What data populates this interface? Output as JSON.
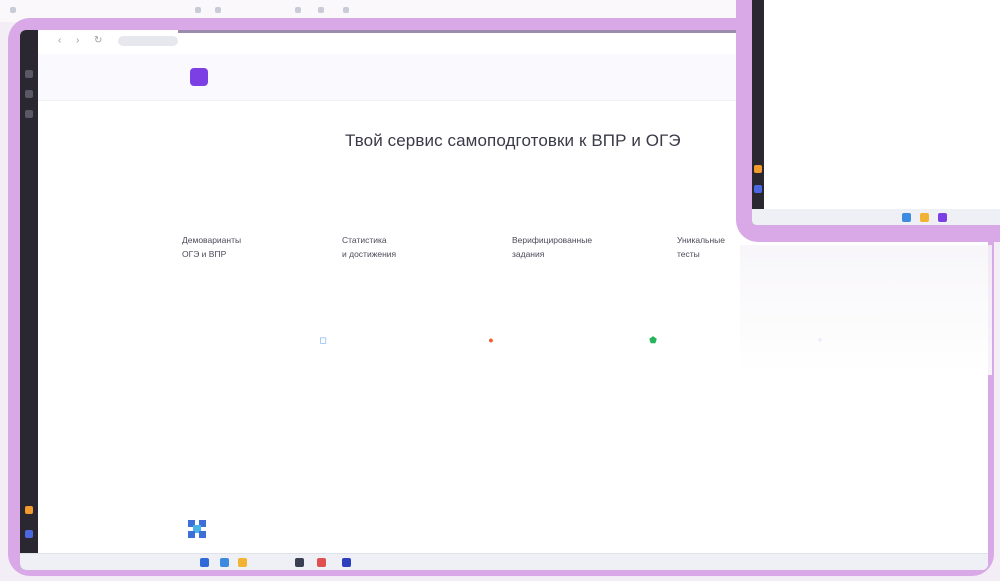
{
  "main": {
    "hero": {
      "title": "Твой сервис самоподготовки к ВПР и ОГЭ"
    },
    "features": [
      {
        "label": "Демоварианты\nОГЭ и ВПР"
      },
      {
        "label": "Статистика\nи достижения"
      },
      {
        "label": "Верифицированные\nзадания"
      },
      {
        "label": "Уникальные\nтесты"
      }
    ]
  },
  "colors": {
    "accent": "#7b3fe4",
    "frame": "#d9a8e6",
    "taskbar": "#eef0f6"
  }
}
